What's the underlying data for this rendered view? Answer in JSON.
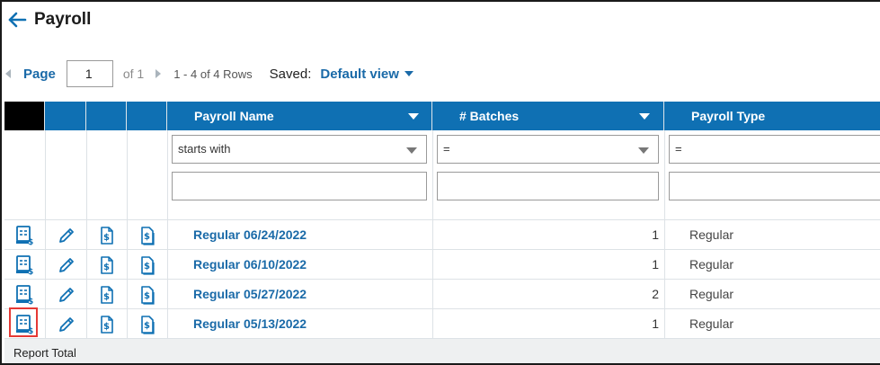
{
  "header": {
    "title": "Payroll",
    "back_icon": "arrow-left-icon"
  },
  "pager": {
    "page_label": "Page",
    "page_value": "1",
    "of_label": "of 1",
    "rows_label": "1 - 4 of 4 Rows",
    "saved_label": "Saved:",
    "view_label": "Default view"
  },
  "columns": [
    {
      "label": "Payroll Name",
      "sortable": true
    },
    {
      "label": "# Batches",
      "sortable": true
    },
    {
      "label": "Payroll Type",
      "sortable": false
    }
  ],
  "filters": {
    "name_operator": "starts with",
    "name_value": "",
    "batches_operator": "=",
    "batches_value": "",
    "type_operator": "=",
    "type_value": ""
  },
  "rows": [
    {
      "name": "Regular 06/24/2022",
      "batches": "1",
      "type": "Regular"
    },
    {
      "name": "Regular 06/10/2022",
      "batches": "1",
      "type": "Regular"
    },
    {
      "name": "Regular 05/27/2022",
      "batches": "2",
      "type": "Regular"
    },
    {
      "name": "Regular 05/13/2022",
      "batches": "1",
      "type": "Regular"
    }
  ],
  "row_icons": [
    "payroll-report-icon",
    "pencil-edit-icon",
    "document-dollar-icon",
    "document-dollar-icon"
  ],
  "footer": {
    "label": "Report Total"
  },
  "colors": {
    "accent": "#0f70b3",
    "link": "#1a6aa8",
    "highlight": "#e53935"
  }
}
